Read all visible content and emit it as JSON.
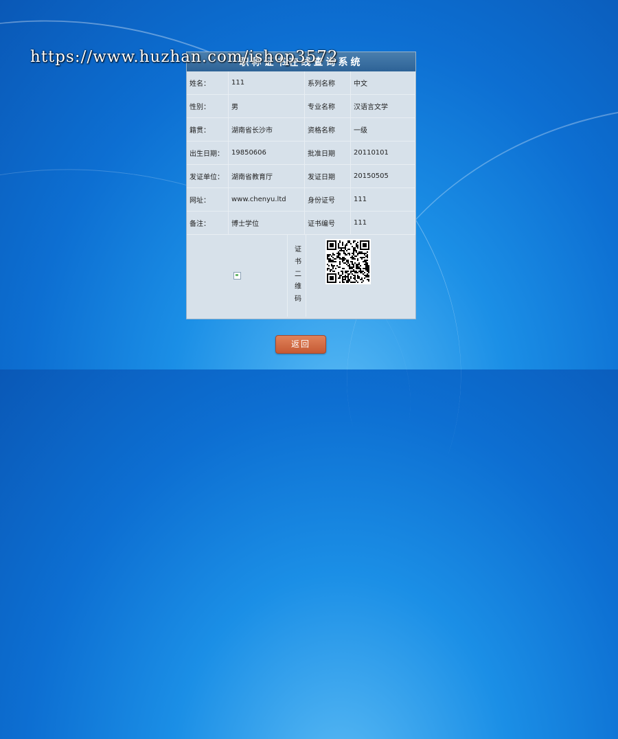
{
  "watermark": "https://www.huzhan.com/ishop3572",
  "panel": {
    "title": "职称证书在线查询系统"
  },
  "rows": [
    {
      "l1": "姓名：",
      "v1": "111",
      "l2": "系列名称",
      "v2": "中文"
    },
    {
      "l1": "性别：",
      "v1": "男",
      "l2": "专业名称",
      "v2": "汉语言文学"
    },
    {
      "l1": "籍贯：",
      "v1": "湖南省长沙市",
      "l2": "资格名称",
      "v2": "一级"
    },
    {
      "l1": "出生日期：",
      "v1": "19850606",
      "l2": "批准日期",
      "v2": "20110101"
    },
    {
      "l1": "发证单位：",
      "v1": "湖南省教育厅",
      "l2": "发证日期",
      "v2": "20150505"
    },
    {
      "l1": "网址：",
      "v1": "www.chenyu.ltd",
      "l2": "身份证号",
      "v2": "111"
    },
    {
      "l1": "备注：",
      "v1": "博士学位",
      "l2": "证书编号",
      "v2": "111"
    }
  ],
  "qr": {
    "label": "证书二维码"
  },
  "back_button": {
    "label": "返回"
  }
}
